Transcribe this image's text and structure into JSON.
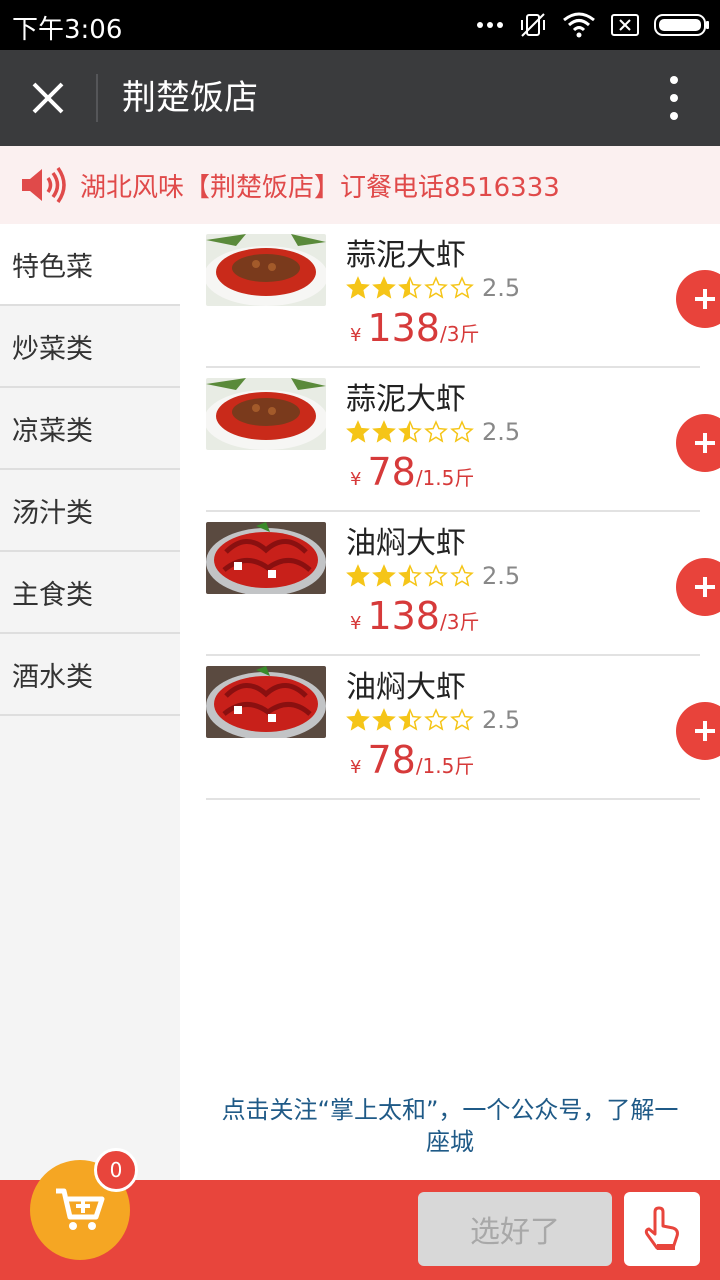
{
  "status_bar": {
    "time": "下午3:06"
  },
  "header": {
    "title": "荆楚饭店"
  },
  "notice": {
    "text": "湖北风味【荆楚饭店】订餐电话8516333"
  },
  "sidebar": {
    "categories": [
      {
        "label": "特色菜",
        "active": true
      },
      {
        "label": "炒菜类"
      },
      {
        "label": "凉菜类"
      },
      {
        "label": "汤汁类"
      },
      {
        "label": "主食类"
      },
      {
        "label": "酒水类"
      }
    ]
  },
  "menu": {
    "items": [
      {
        "name": "蒜泥大虾",
        "rating": "2.5",
        "currency": "¥",
        "price": "138",
        "unit": "/3斤",
        "image_icon": "garlic-crayfish-photo"
      },
      {
        "name": "蒜泥大虾",
        "rating": "2.5",
        "currency": "¥",
        "price": "78",
        "unit": "/1.5斤",
        "image_icon": "garlic-crayfish-photo"
      },
      {
        "name": "油焖大虾",
        "rating": "2.5",
        "currency": "¥",
        "price": "138",
        "unit": "/3斤",
        "image_icon": "braised-crayfish-photo"
      },
      {
        "name": "油焖大虾",
        "rating": "2.5",
        "currency": "¥",
        "price": "78",
        "unit": "/1.5斤",
        "image_icon": "braised-crayfish-photo"
      }
    ]
  },
  "promo": {
    "line1": "点击关注“掌上太和”，一个公众号，了解一",
    "line2": "座城"
  },
  "bottom_bar": {
    "cart_count": "0",
    "done_label": "选好了"
  },
  "colors": {
    "accent": "#e8453c",
    "cart": "#f5a623",
    "star": "#f5c518",
    "price": "#d63a3a",
    "link": "#1f5a87"
  }
}
